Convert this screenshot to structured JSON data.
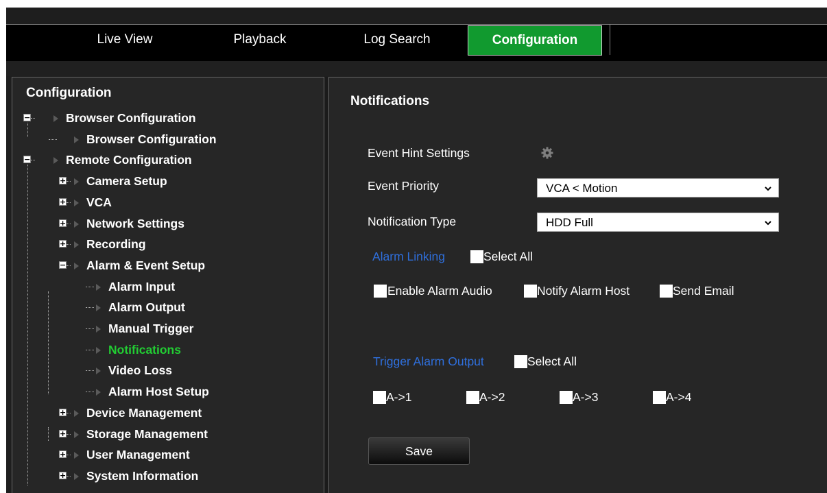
{
  "nav": {
    "tabs": [
      {
        "label": "Live View"
      },
      {
        "label": "Playback"
      },
      {
        "label": "Log Search"
      },
      {
        "label": "Configuration",
        "active": true
      }
    ]
  },
  "sidebar": {
    "title": "Configuration",
    "items": [
      {
        "label": "Browser Configuration",
        "level": 0,
        "expander": "minus"
      },
      {
        "label": "Browser Configuration",
        "level": 1
      },
      {
        "label": "Remote Configuration",
        "level": 0,
        "expander": "minus"
      },
      {
        "label": "Camera Setup",
        "level": 1,
        "expander": "plus"
      },
      {
        "label": "VCA",
        "level": 1,
        "expander": "plus"
      },
      {
        "label": "Network Settings",
        "level": 1,
        "expander": "plus"
      },
      {
        "label": "Recording",
        "level": 1,
        "expander": "plus"
      },
      {
        "label": "Alarm & Event Setup",
        "level": 1,
        "expander": "minus"
      },
      {
        "label": "Alarm Input",
        "level": 2
      },
      {
        "label": "Alarm Output",
        "level": 2
      },
      {
        "label": "Manual Trigger",
        "level": 2
      },
      {
        "label": "Notifications",
        "level": 2,
        "selected": true
      },
      {
        "label": "Video Loss",
        "level": 2
      },
      {
        "label": "Alarm Host Setup",
        "level": 2
      },
      {
        "label": "Device Management",
        "level": 1,
        "expander": "plus"
      },
      {
        "label": "Storage Management",
        "level": 1,
        "expander": "plus"
      },
      {
        "label": "User Management",
        "level": 1,
        "expander": "plus"
      },
      {
        "label": "System Information",
        "level": 1,
        "expander": "plus"
      }
    ],
    "selected_color": "#22cc33"
  },
  "main": {
    "title": "Notifications",
    "event_hint_label": "Event Hint Settings",
    "event_hint_icon": "gear-icon",
    "event_priority_label": "Event Priority",
    "event_priority_value": "VCA < Motion",
    "notification_type_label": "Notification Type",
    "notification_type_value": "HDD Full",
    "alarm_linking_label": "Alarm Linking",
    "alarm_linking_select_all": "Select All",
    "linking_options": [
      "Enable Alarm Audio",
      "Notify Alarm Host",
      "Send Email"
    ],
    "trigger_output_label": "Trigger Alarm Output",
    "trigger_select_all": "Select All",
    "outputs": [
      "A->1",
      "A->2",
      "A->3",
      "A->4"
    ],
    "save_label": "Save"
  },
  "colors": {
    "active_tab": "#119a2f",
    "section_label": "#2f6fdc",
    "background": "#262626"
  }
}
